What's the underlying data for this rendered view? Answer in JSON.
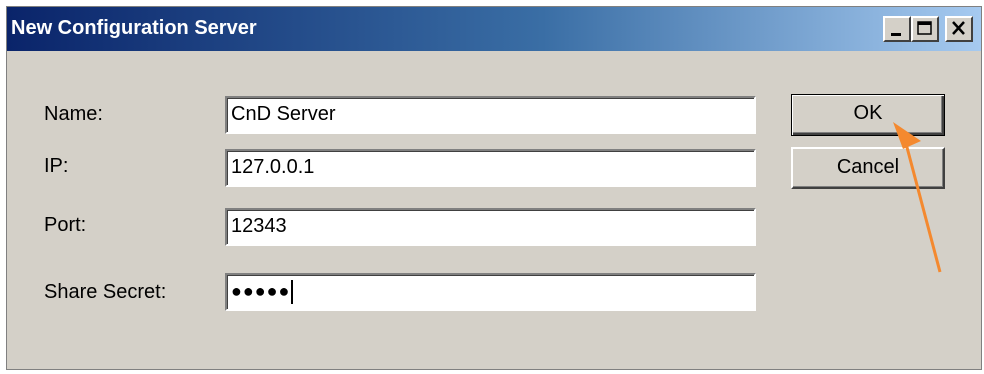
{
  "window": {
    "title": "New Configuration Server",
    "controls": [
      "minimize-icon",
      "maximize-icon",
      "close-icon"
    ]
  },
  "form": {
    "name_label": "Name:",
    "name_value": "CnD Server",
    "ip_label": "IP:",
    "ip_value": "127.0.0.1",
    "port_label": "Port:",
    "port_value": "12343",
    "secret_label": "Share Secret:",
    "secret_value": "●●●●●"
  },
  "buttons": {
    "ok_label": "OK",
    "cancel_label": "Cancel"
  },
  "annotation": {
    "arrow_color": "#f4892f"
  }
}
